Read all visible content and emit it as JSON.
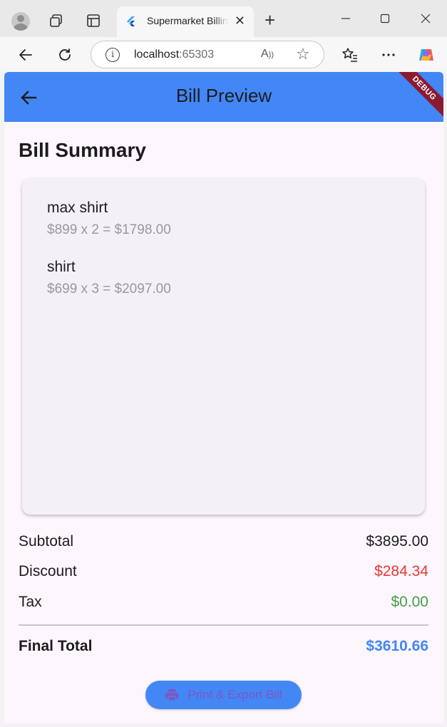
{
  "browser": {
    "tab_title": "Supermarket Billing",
    "url_host": "localhost",
    "url_port": ":65303"
  },
  "app": {
    "title": "Bill Preview",
    "debug_label": "DEBUG",
    "section_title": "Bill Summary",
    "items": [
      {
        "name": "max shirt",
        "detail": "$899 x 2 = $1798.00"
      },
      {
        "name": "shirt",
        "detail": "$699 x 3 = $2097.00"
      }
    ],
    "totals": {
      "subtotal_label": "Subtotal",
      "subtotal_value": "$3895.00",
      "discount_label": "Discount",
      "discount_value": "$284.34",
      "tax_label": "Tax",
      "tax_value": "$0.00",
      "final_label": "Final Total",
      "final_value": "$3610.66"
    },
    "print_button_label": "Print & Export Bill"
  },
  "colors": {
    "primary": "#4287f5",
    "discount": "#e53935",
    "tax": "#43a047",
    "final_total": "#4287f5",
    "button_text": "#7e57c2"
  }
}
